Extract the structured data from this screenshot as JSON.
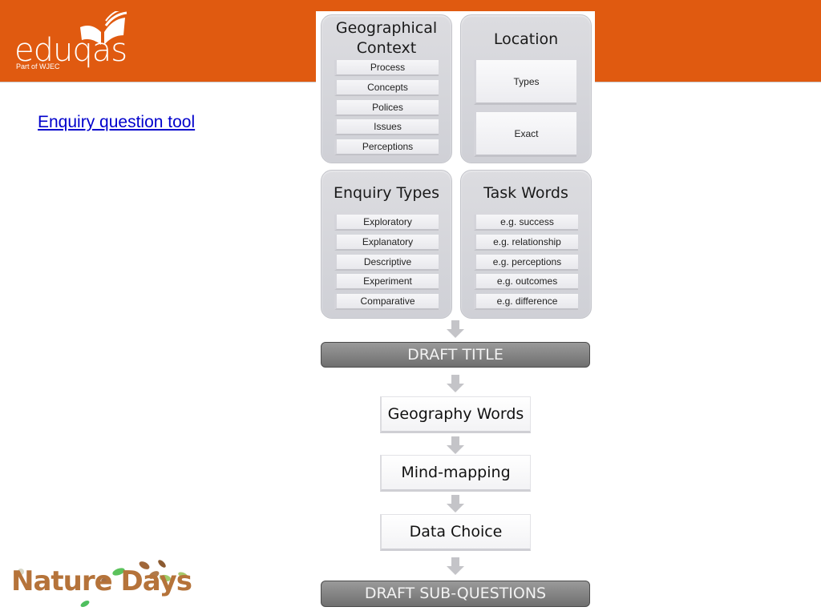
{
  "header": {
    "brand": "eduqas",
    "brand_sub": "Part of WJEC",
    "banner_color": "#e05a10"
  },
  "link": {
    "label": "Enquiry question tool",
    "color": "#0000cc"
  },
  "diagram": {
    "panels": {
      "geographical_context": {
        "title_line1": "Geographical",
        "title_line2": "Context",
        "items": [
          "Process",
          "Concepts",
          "Polices",
          "Issues",
          "Perceptions"
        ]
      },
      "location": {
        "title": "Location",
        "items": [
          "Types",
          "Exact"
        ]
      },
      "enquiry_types": {
        "title": "Enquiry Types",
        "items": [
          "Exploratory",
          "Explanatory",
          "Descriptive",
          "Experiment",
          "Comparative"
        ]
      },
      "task_words": {
        "title": "Task Words",
        "items": [
          "e.g. success",
          "e.g. relationship",
          "e.g. perceptions",
          "e.g. outcomes",
          "e.g. difference"
        ]
      }
    },
    "draft_title": "DRAFT TITLE",
    "steps": [
      "Geography Words",
      "Mind-mapping",
      "Data Choice"
    ],
    "draft_sub_questions": "DRAFT SUB-QUESTIONS"
  },
  "footer_logo": {
    "text": "Nature Days"
  }
}
